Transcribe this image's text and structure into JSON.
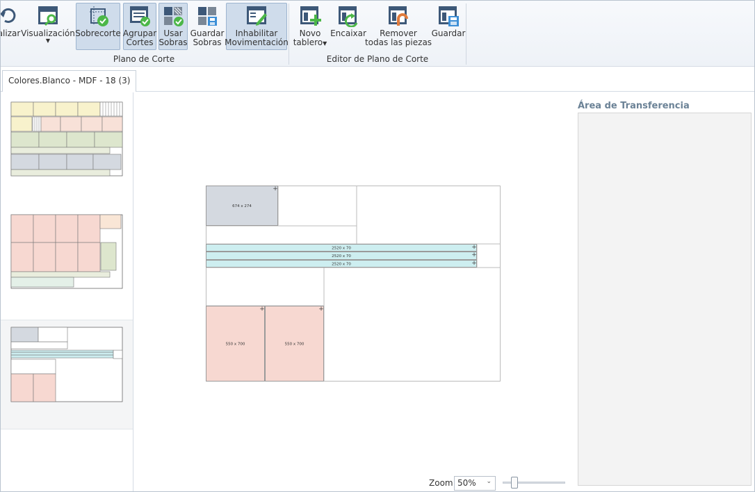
{
  "ribbon": {
    "buttons": {
      "atualizar": "alizar",
      "visualizacao": "Visualización",
      "sobrecorte": "Sobrecorte",
      "agrupar_1": "Agrupar",
      "agrupar_2": "Cortes",
      "usar_1": "Usar",
      "usar_2": "Sobras",
      "guardar_sobras_1": "Guardar",
      "guardar_sobras_2": "Sobras",
      "habilitar_1": "Inhabilitar",
      "habilitar_2": "Movimentación",
      "novo_1": "Novo",
      "novo_2": "tablero",
      "encaixar": "Encaixar",
      "remover_1": "Remover",
      "remover_2": "todas las piezas",
      "guardar": "Guardar"
    },
    "groups": {
      "plano": "Plano de Corte",
      "editor": "Editor de Plano de Corte"
    },
    "icons": [
      "refresh-icon",
      "visualization-icon",
      "sobrecorte-icon",
      "group-cuts-icon",
      "use-leftovers-icon",
      "save-leftovers-icon",
      "toggle-movement-icon",
      "new-board-icon",
      "fit-icon",
      "remove-pieces-icon",
      "save-icon"
    ],
    "accent": "#4cb748",
    "icon_color": "#3d5878"
  },
  "tabs": [
    {
      "label": "Colores.Blanco - MDF - 18 (3)"
    }
  ],
  "canvas": {
    "pieces": [
      {
        "label": "674 x 274",
        "color": "#d4d9e0"
      },
      {
        "label": "2520 x 70",
        "color": "#cdeef0"
      },
      {
        "label": "2520 x 70",
        "color": "#cdeef0"
      },
      {
        "label": "2520 x 70",
        "color": "#cdeef0"
      },
      {
        "label": "550 x 700",
        "color": "#f7d8d1"
      },
      {
        "label": "550 x 700",
        "color": "#f7d8d1"
      }
    ]
  },
  "transfer": {
    "title": "Área de Transferencia"
  },
  "zoom": {
    "label": "Zoom",
    "value": "50%",
    "slider_fraction": 0.18
  }
}
